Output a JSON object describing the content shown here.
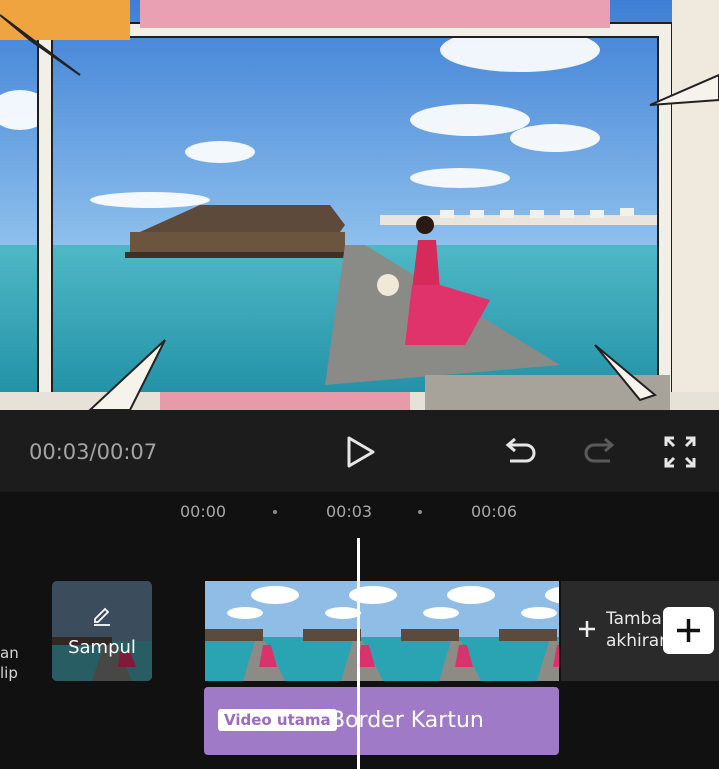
{
  "player": {
    "time": "00:03/00:07"
  },
  "timeline": {
    "ruler": [
      "00:00",
      "00:03",
      "00:06"
    ],
    "cover_label": "Sampul",
    "left_cut": [
      "an",
      "lip"
    ],
    "end_card_line1": "Tamba",
    "end_card_line2": "akhiran",
    "track_badge": "Video utama",
    "track_title": "Border Kartun"
  },
  "colors": {
    "control_bg": "#1c1c1c",
    "timeline_bg": "#111111",
    "track_purple": "#9f7ac6"
  },
  "icons": [
    "play-icon",
    "undo-icon",
    "redo-icon",
    "fullscreen-icon",
    "pencil-icon",
    "plus-icon"
  ]
}
